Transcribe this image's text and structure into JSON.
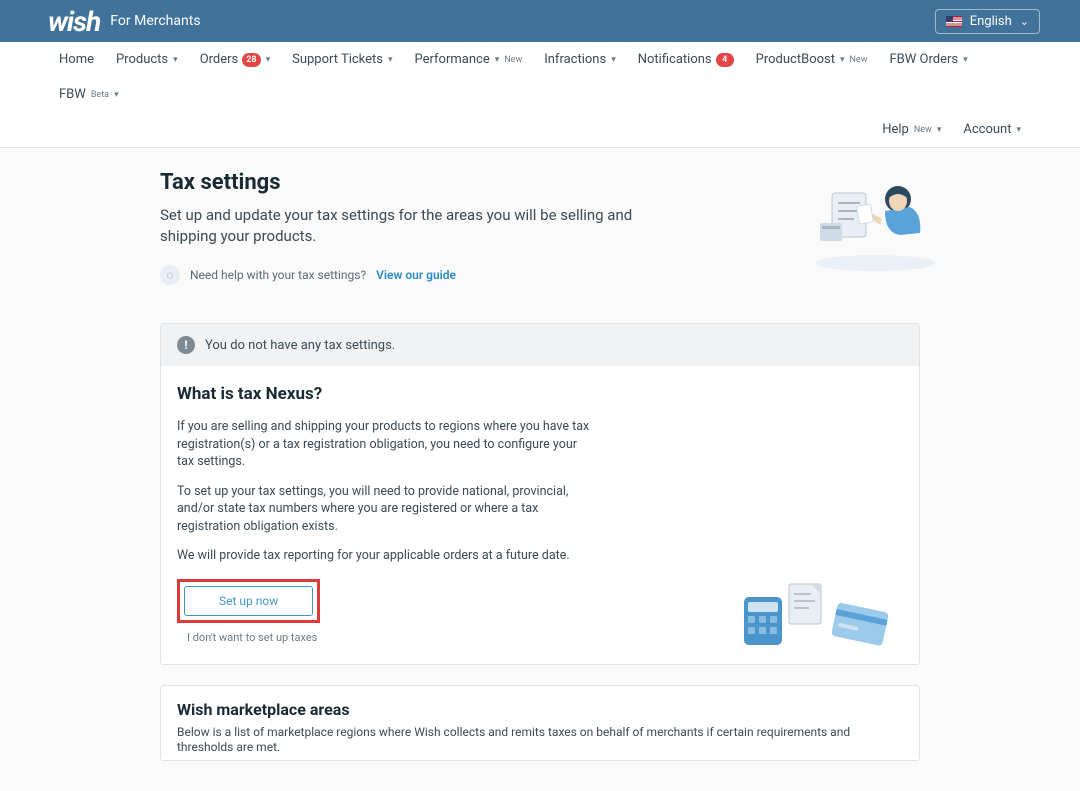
{
  "header": {
    "brand": "wish",
    "brand_sub": "For Merchants",
    "language": "English"
  },
  "nav": {
    "home": "Home",
    "products": "Products",
    "orders": "Orders",
    "orders_badge": "28",
    "support_tickets": "Support Tickets",
    "performance": "Performance",
    "performance_sup": "New",
    "infractions": "Infractions",
    "notifications": "Notifications",
    "notifications_badge": "4",
    "productboost": "ProductBoost",
    "productboost_sup": "New",
    "fbw_orders": "FBW Orders",
    "fbw": "FBW",
    "fbw_sup": "Beta",
    "help": "Help",
    "help_sup": "New",
    "account": "Account"
  },
  "page": {
    "title": "Tax settings",
    "subtitle": "Set up and update your tax settings for the areas you will be selling and shipping your products.",
    "help_text": "Need help with your tax settings?",
    "help_link": "View our guide"
  },
  "notice": {
    "banner": "You do not have any tax settings.",
    "nexus_title": "What is tax Nexus?",
    "nexus_p1": "If you are selling and shipping your products to regions where you have tax registration(s) or a tax registration obligation, you need to configure your tax settings.",
    "nexus_p2": "To set up your tax settings, you will need to provide national, provincial, and/or state tax numbers where you are registered or where a tax registration obligation exists.",
    "nexus_p3": "We will provide tax reporting for your applicable orders at a future date.",
    "setup_btn": "Set up now",
    "opt_out": "I don't want to set up taxes"
  },
  "marketplace": {
    "title": "Wish marketplace areas",
    "sub": "Below is a list of marketplace regions where Wish collects and remits taxes on behalf of merchants if certain requirements and thresholds are met."
  }
}
